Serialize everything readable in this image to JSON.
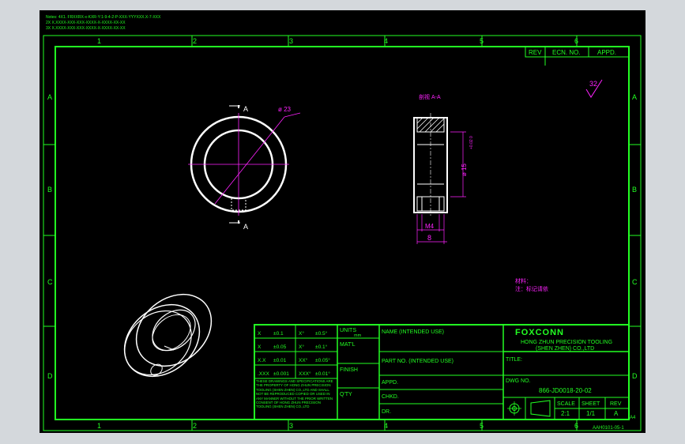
{
  "drawing": {
    "notes_header": [
      "Notes: 4X1. FRXXRX-x-KXR-Y:1-9-4-2-P-XXX-YYYXXX.X-7-XXX",
      "2X  X.XXXX-XXX-XXX-XXXX-X-XXXX-XX-XX",
      "3X  X.XXXX-XXX-XXX-XXXX-X-XXXX-XX-XX"
    ],
    "column_numbers": [
      "1",
      "2",
      "3",
      "4",
      "5",
      "6"
    ],
    "row_letters": [
      "A",
      "B",
      "C",
      "D"
    ],
    "revision_header": {
      "rev": "REV",
      "ecn": "ECN. NO.",
      "appd": "APPD."
    },
    "surface_finish": "32",
    "views": {
      "section_label": "A",
      "diameter_outer": "ø 23",
      "section_view_title": "剖视 A-A",
      "diameter_bore": "ø 15",
      "diameter_bore_tol": "+0.02 0",
      "thread_callout": "M4",
      "width_dim": "8"
    },
    "material_notes": [
      "材料：",
      "注：标记请依"
    ],
    "title_block": {
      "tolerances": [
        [
          "X",
          "±0.1",
          "X°",
          "±0.5°"
        ],
        [
          "X",
          "±0.05",
          "X°",
          "±0.1°"
        ],
        [
          "X.X",
          "±0.01",
          "XX°",
          "±0.05°"
        ],
        [
          ".XXX",
          "±0.001",
          "XXX°",
          "±0.01°"
        ]
      ],
      "disclaimer": "THESE DRAWINGS AND SPECIFICATIONS ARE THE PROPERTY OF HONG ZHUN PRECISION TOOLING (SHEN ZHEN) CO.,LTD AND SHALL NOT BE REPRODUCED COPIED OR USED IN ANY MANNER WITHOUT THE PRIOR WRITTEN CONSENT OF HONG ZHUN PRECISION TOOLING (SHEN ZHEN) CO.,LTD",
      "units_label": "UNITS",
      "units_value": "mm",
      "matl_label": "MAT'L",
      "finish_label": "FINISH",
      "qty_label": "Q'TY",
      "name_label": "NAME (INTENDED USE)",
      "part_no_label": "PART NO. (INTENDED USE)",
      "appd_label": "APPD.",
      "chkd_label": "CHKD.",
      "dr_label": "DR.",
      "company_logo": "FOXCONN",
      "company_line1": "HONG ZHUN PRECISION TOOLING",
      "company_line2": "(SHEN ZHEN) CO.,LTD",
      "title_label": "TITLE:",
      "dwg_no_label": "DWG NO.",
      "dwg_no": "866-JD0018-20-02",
      "scale_label": "SCALE",
      "scale_value": "2:1",
      "sheet_label": "SHEET",
      "sheet_value": "1/1",
      "rev_label": "REV",
      "rev_value": "A",
      "size": "A4",
      "form_no": "AAH0101-05-1"
    }
  }
}
